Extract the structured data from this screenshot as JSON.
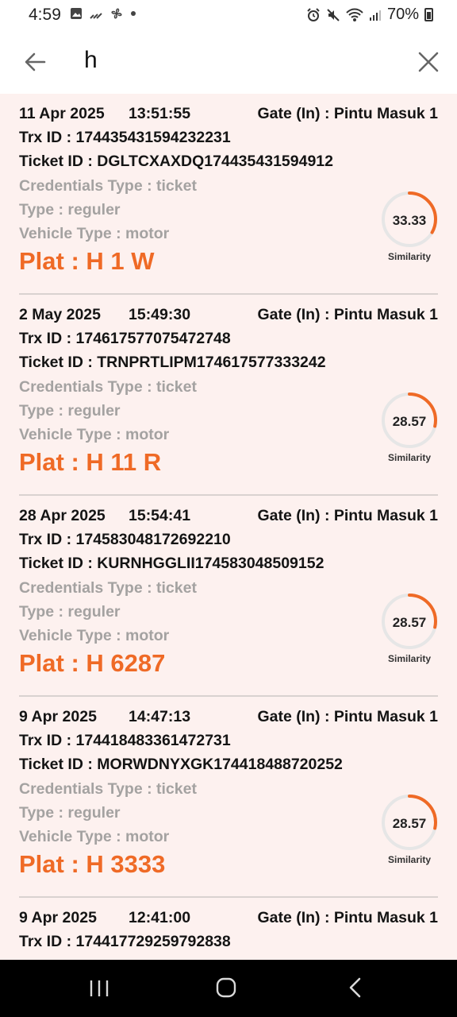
{
  "status_bar": {
    "time": "4:59",
    "battery": "70%"
  },
  "search": {
    "query": "h"
  },
  "labels": {
    "similarity": "Similarity"
  },
  "colors": {
    "accent": "#ef6a26",
    "list_background": "#fdf1ef",
    "gauge_track": "#e6e6e6"
  },
  "results": [
    {
      "date": "11 Apr 2025",
      "time": "13:51:55",
      "gate": "Gate (In) : Pintu Masuk 1",
      "trx": "Trx ID : 174435431594232231",
      "ticket": "Ticket ID : DGLTCXAXDQ174435431594912",
      "credentials": "Credentials Type : ticket",
      "type": "Type : reguler",
      "vehicle": "Vehicle Type : motor",
      "plat": "Plat : H 1 W",
      "similarity": "33.33",
      "similarity_value": 33.33
    },
    {
      "date": "2 May 2025",
      "time": "15:49:30",
      "gate": "Gate (In) : Pintu Masuk 1",
      "trx": "Trx ID : 174617577075472748",
      "ticket": "Ticket ID : TRNPRTLIPM174617577333242",
      "credentials": "Credentials Type : ticket",
      "type": "Type : reguler",
      "vehicle": "Vehicle Type : motor",
      "plat": "Plat : H 11 R",
      "similarity": "28.57",
      "similarity_value": 28.57
    },
    {
      "date": "28 Apr 2025",
      "time": "15:54:41",
      "gate": "Gate (In) : Pintu Masuk 1",
      "trx": "Trx ID : 174583048172692210",
      "ticket": "Ticket ID : KURNHGGLII174583048509152",
      "credentials": "Credentials Type : ticket",
      "type": "Type : reguler",
      "vehicle": "Vehicle Type : motor",
      "plat": "Plat : H 6287",
      "similarity": "28.57",
      "similarity_value": 28.57
    },
    {
      "date": "9 Apr 2025",
      "time": "14:47:13",
      "gate": "Gate (In) : Pintu Masuk 1",
      "trx": "Trx ID : 174418483361472731",
      "ticket": "Ticket ID : MORWDNYXGK174418488720252",
      "credentials": "Credentials Type : ticket",
      "type": "Type : reguler",
      "vehicle": "Vehicle Type : motor",
      "plat": "Plat : H 3333",
      "similarity": "28.57",
      "similarity_value": 28.57
    },
    {
      "date": "9 Apr 2025",
      "time": "12:41:00",
      "gate": "Gate (In) : Pintu Masuk 1",
      "trx": "Trx ID : 174417729259792838"
    }
  ]
}
